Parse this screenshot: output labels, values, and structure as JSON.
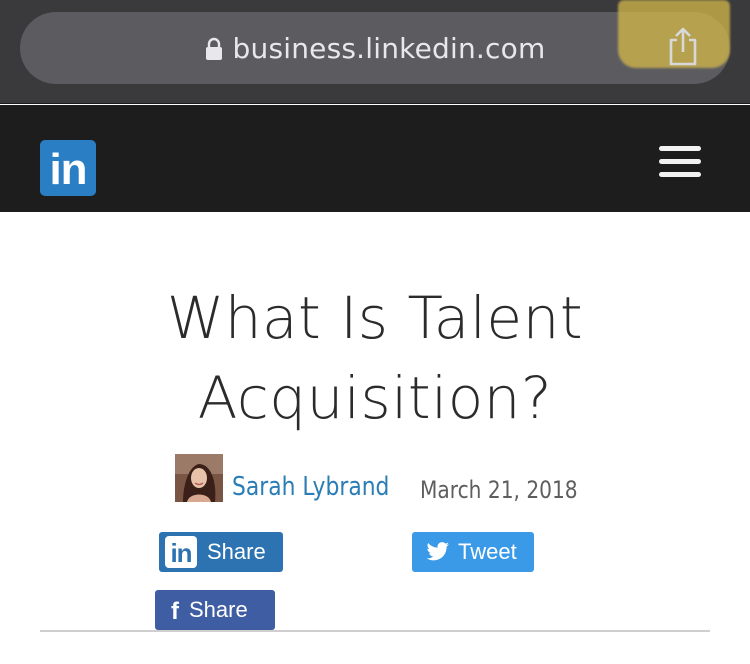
{
  "browser": {
    "url": "business.linkedin.com",
    "icons": [
      "lock-icon",
      "share-icon"
    ]
  },
  "header": {
    "logo_text": "in",
    "icons": [
      "linkedin-logo-icon",
      "hamburger-menu-icon"
    ]
  },
  "article": {
    "title_line1": "What Is Talent",
    "title_line2": "Acquisition?",
    "author": "Sarah Lybrand",
    "date": "March 21, 2018"
  },
  "share": {
    "linkedin_label": "Share",
    "linkedin_icon_text": "in",
    "twitter_label": "Tweet",
    "facebook_label": "Share",
    "facebook_icon_text": "f"
  },
  "colors": {
    "browser_bar": "#3a3a3c",
    "url_field": "#5c5c60",
    "header_bg": "#1d1d1d",
    "linkedin_blue": "#2a7ec3",
    "author_link": "#2a7db5",
    "twitter_blue": "#3a9ae8",
    "facebook_blue": "#3f5da3"
  }
}
